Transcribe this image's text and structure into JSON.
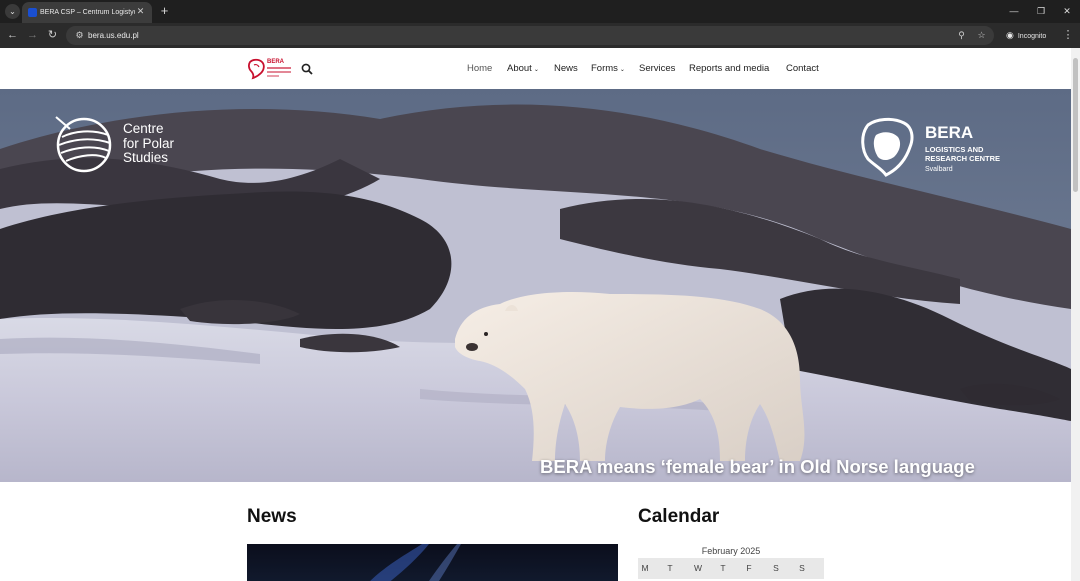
{
  "browser": {
    "tab_title": "BERA CSP – Centrum Logistyczne",
    "url": "bera.us.edu.pl",
    "incognito_label": "Incognito"
  },
  "site": {
    "logo_text": "BERA",
    "nav": [
      {
        "label": "Home",
        "active": true
      },
      {
        "label": "About",
        "dropdown": true
      },
      {
        "label": "News"
      },
      {
        "label": "Forms",
        "dropdown": true
      },
      {
        "label": "Services"
      },
      {
        "label": "Reports and media"
      },
      {
        "label": "Contact"
      }
    ]
  },
  "hero": {
    "caption": "BERA means ‘female bear’ in Old Norse language",
    "left_logo_lines": [
      "Centre",
      "for Polar",
      "Studies"
    ],
    "right_logo_title": "BERA",
    "right_logo_subtitle_lines": [
      "LOGISTICS AND",
      "RESEARCH CENTRE"
    ],
    "right_logo_location": "Svalbard"
  },
  "news": {
    "heading": "News"
  },
  "calendar": {
    "heading": "Calendar",
    "month": "February 2025",
    "weekdays": [
      "M",
      "T",
      "W",
      "T",
      "F",
      "S",
      "S"
    ]
  },
  "colors": {
    "brand_red": "#c8102e",
    "chrome_dark": "#1f1f1f",
    "toolbar_dark": "#2b2b2b"
  },
  "icons": [
    "tab-search-icon",
    "favicon-icon",
    "close-icon",
    "plus-icon",
    "minimize-icon",
    "restore-icon",
    "window-close-icon",
    "back-arrow-icon",
    "forward-arrow-icon",
    "reload-icon",
    "site-info-icon",
    "zoom-icon",
    "star-icon",
    "incognito-icon",
    "kebab-menu-icon",
    "search-icon",
    "chevron-down-icon"
  ]
}
